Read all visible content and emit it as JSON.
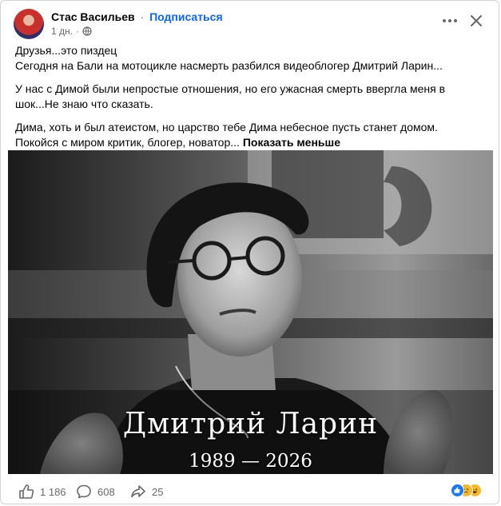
{
  "post": {
    "author": "Стас Васильев",
    "separator": "·",
    "subscribe_label": "Подписаться",
    "time": "1 дн.",
    "time_separator": "·",
    "text": {
      "line1": "Друзья...это пиздец",
      "line2": "Сегодня на Бали на мотоцикле насмерть разбился видеоблогер Дмитрий Ларин...",
      "line3": "У нас с Димой были непростые отношения, но его ужасная смерть ввергла меня в шок...Не знаю что сказать.",
      "line4": "Дима, хоть и был атеистом, но царство тебе Дима небесное пусть станет домом.",
      "line5": "Покойся с миром критик, блогер, новатор...",
      "show_less": "Показать меньше"
    },
    "image": {
      "name": "Дмитрий Ларин",
      "years": "1989 — 2026"
    },
    "footer": {
      "likes": "1 186",
      "comments": "608",
      "shares": "25"
    },
    "colors": {
      "link": "#0866ff",
      "secondary_text": "#65676b",
      "like_blue": "#1877f2",
      "sad_yellow": "#f7b928"
    },
    "icons": {
      "more": "more-icon",
      "close": "close-icon",
      "globe": "globe-icon",
      "like": "like-icon",
      "comment": "comment-icon",
      "share": "share-icon"
    }
  }
}
